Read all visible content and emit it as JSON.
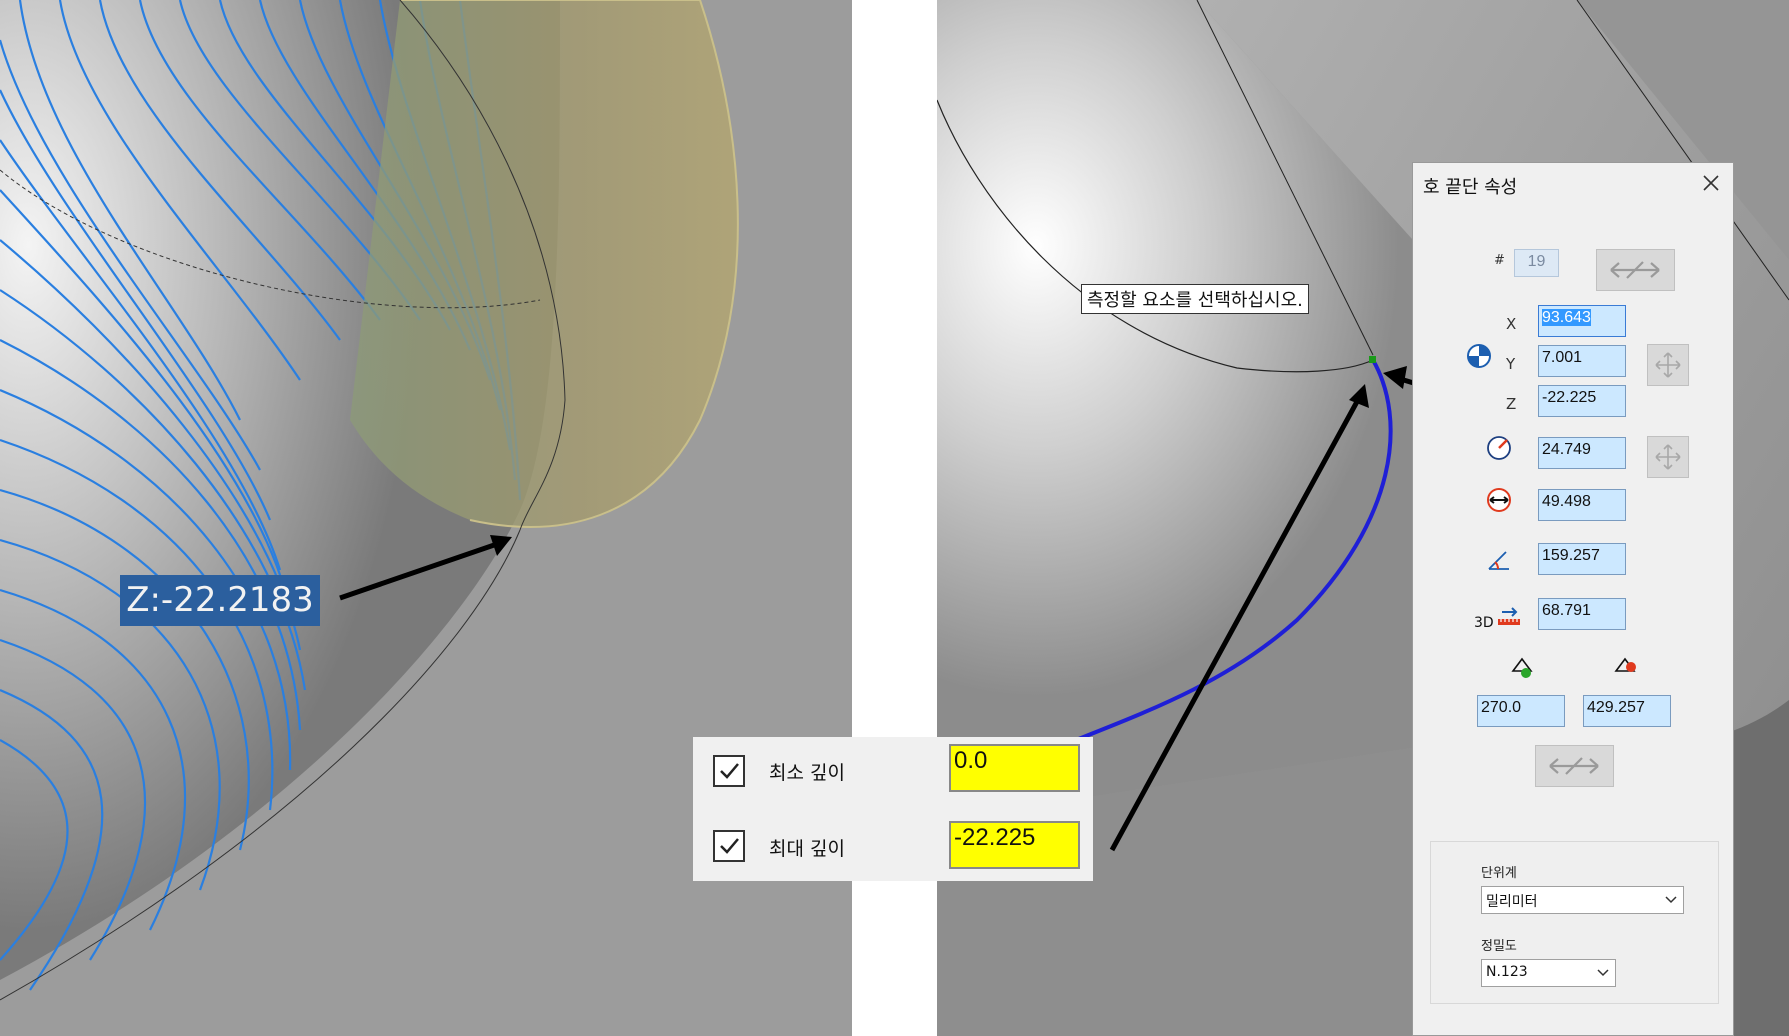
{
  "left_view": {
    "z_label": "Z:-22.2183"
  },
  "prompt_text": "측정할 요소를 선택하십시오.",
  "depth_panel": {
    "min_label": "최소 깊이",
    "min_value": "0.0",
    "min_checked": true,
    "max_label": "최대 깊이",
    "max_value": "-22.225",
    "max_checked": true
  },
  "properties_dialog": {
    "title": "호 끝단 속성",
    "number_label": "#",
    "number_value": "19",
    "x_label": "X",
    "x_value": "93.643",
    "y_label": "Y",
    "y_value": "7.001",
    "z_label": "Z",
    "z_value": "-22.225",
    "radius_value": "24.749",
    "diameter_value": "49.498",
    "angle_value": "159.257",
    "length_3d_label": "3D",
    "length_3d_value": "68.791",
    "start_angle_value": "270.0",
    "end_angle_value": "429.257",
    "units_label": "단위계",
    "units_value": "밀리미터",
    "precision_label": "정밀도",
    "precision_value": "N.123"
  }
}
